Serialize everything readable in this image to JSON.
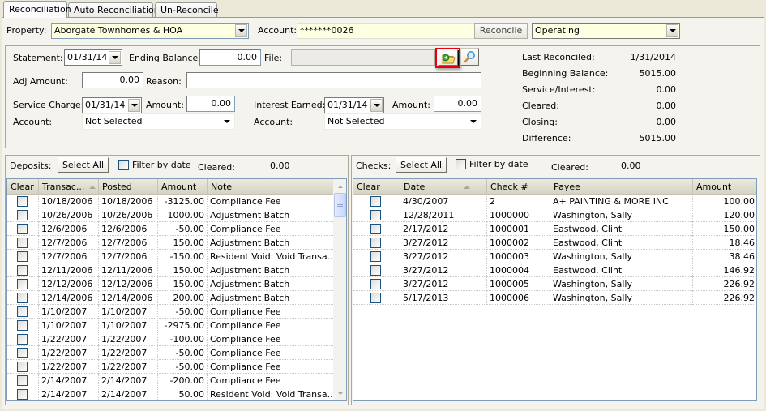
{
  "tabs": [
    {
      "label": "Reconciliation",
      "active": true
    },
    {
      "label": "Auto Reconciliation",
      "active": false
    },
    {
      "label": "Un-Reconcile",
      "active": false
    }
  ],
  "header": {
    "property_label": "Property:",
    "property_value": "Aborgate Townhomes & HOA",
    "account_label": "Account:",
    "account_value": "*******0026",
    "reconcile_button": "Reconcile",
    "account_type_value": "Operating"
  },
  "statement": {
    "statement_label": "Statement:",
    "statement_date": "01/31/14",
    "ending_balance_label": "Ending Balance:",
    "ending_balance_value": "0.00",
    "file_label": "File:",
    "file_value": "",
    "adj_amount_label": "Adj Amount:",
    "adj_amount_value": "0.00",
    "reason_label": "Reason:",
    "reason_value": "",
    "service_charge_label": "Service Charge:",
    "service_charge_date": "01/31/14",
    "service_amount_label": "Amount:",
    "service_amount_value": "0.00",
    "service_account_label": "Account:",
    "service_account_value": "Not Selected",
    "interest_earned_label": "Interest Earned:",
    "interest_earned_date": "01/31/14",
    "interest_amount_label": "Amount:",
    "interest_amount_value": "0.00",
    "interest_account_label": "Account:",
    "interest_account_value": "Not Selected",
    "icons": {
      "open_file": "folder-open-icon",
      "view_file": "magnifier-icon"
    }
  },
  "summary": [
    {
      "label": "Last Reconciled:",
      "value": "1/31/2014"
    },
    {
      "label": "Beginning Balance:",
      "value": "5015.00"
    },
    {
      "label": "Service/Interest:",
      "value": "0.00"
    },
    {
      "label": "Cleared:",
      "value": "0.00"
    },
    {
      "label": "Closing:",
      "value": "0.00"
    },
    {
      "label": "Difference:",
      "value": "5015.00"
    }
  ],
  "deposits": {
    "title": "Deposits:",
    "select_all": "Select All",
    "filter_label": "Filter by date",
    "filter_checked": false,
    "cleared_label": "Cleared:",
    "cleared_value": "0.00",
    "columns": [
      "Clear",
      "Transac...",
      "Posted",
      "Amount",
      "Note"
    ],
    "sorted_column": "Transac...",
    "rows": [
      {
        "clear": false,
        "transaction": "10/18/2006",
        "posted": "10/18/2006",
        "amount": "-3125.00",
        "note": "Compliance Fee"
      },
      {
        "clear": false,
        "transaction": "10/26/2006",
        "posted": "10/26/2006",
        "amount": "1000.00",
        "note": "Adjustment Batch"
      },
      {
        "clear": false,
        "transaction": "12/6/2006",
        "posted": "12/6/2006",
        "amount": "-50.00",
        "note": "Compliance Fee"
      },
      {
        "clear": false,
        "transaction": "12/7/2006",
        "posted": "12/7/2006",
        "amount": "150.00",
        "note": "Adjustment Batch"
      },
      {
        "clear": false,
        "transaction": "12/7/2006",
        "posted": "12/7/2006",
        "amount": "-150.00",
        "note": "Resident Void: Void Transa..."
      },
      {
        "clear": false,
        "transaction": "12/11/2006",
        "posted": "12/11/2006",
        "amount": "150.00",
        "note": "Adjustment Batch"
      },
      {
        "clear": false,
        "transaction": "12/12/2006",
        "posted": "12/12/2006",
        "amount": "150.00",
        "note": "Adjustment Batch"
      },
      {
        "clear": false,
        "transaction": "12/14/2006",
        "posted": "12/14/2006",
        "amount": "200.00",
        "note": "Adjustment Batch"
      },
      {
        "clear": false,
        "transaction": "1/10/2007",
        "posted": "1/10/2007",
        "amount": "-50.00",
        "note": "Compliance Fee"
      },
      {
        "clear": false,
        "transaction": "1/10/2007",
        "posted": "1/10/2007",
        "amount": "-2975.00",
        "note": "Compliance Fee"
      },
      {
        "clear": false,
        "transaction": "1/22/2007",
        "posted": "1/22/2007",
        "amount": "-100.00",
        "note": "Compliance Fee"
      },
      {
        "clear": false,
        "transaction": "1/22/2007",
        "posted": "1/22/2007",
        "amount": "-50.00",
        "note": "Compliance Fee"
      },
      {
        "clear": false,
        "transaction": "1/22/2007",
        "posted": "1/22/2007",
        "amount": "-50.00",
        "note": "Compliance Fee"
      },
      {
        "clear": false,
        "transaction": "2/14/2007",
        "posted": "2/14/2007",
        "amount": "-200.00",
        "note": "Compliance Fee"
      },
      {
        "clear": false,
        "transaction": "2/14/2007",
        "posted": "2/14/2007",
        "amount": "50.00",
        "note": "Resident Void: Void Transa..."
      }
    ]
  },
  "checks": {
    "title": "Checks:",
    "select_all": "Select All",
    "filter_label": "Filter by date",
    "filter_checked": false,
    "cleared_label": "Cleared:",
    "cleared_value": "0.00",
    "columns": [
      "Clear",
      "Date",
      "Check #",
      "Payee",
      "Amount"
    ],
    "sorted_column": "Date",
    "rows": [
      {
        "clear": false,
        "date": "4/30/2007",
        "check": "2",
        "payee": "A+ PAINTING & MORE INC",
        "amount": "100.00"
      },
      {
        "clear": false,
        "date": "12/28/2011",
        "check": "1000000",
        "payee": "Washington, Sally",
        "amount": "120.00"
      },
      {
        "clear": false,
        "date": "2/17/2012",
        "check": "1000001",
        "payee": "Eastwood, Clint",
        "amount": "150.00"
      },
      {
        "clear": false,
        "date": "3/27/2012",
        "check": "1000002",
        "payee": "Eastwood, Clint",
        "amount": "18.46"
      },
      {
        "clear": false,
        "date": "3/27/2012",
        "check": "1000003",
        "payee": "Washington, Sally",
        "amount": "38.46"
      },
      {
        "clear": false,
        "date": "3/27/2012",
        "check": "1000004",
        "payee": "Eastwood, Clint",
        "amount": "146.92"
      },
      {
        "clear": false,
        "date": "3/27/2012",
        "check": "1000005",
        "payee": "Washington, Sally",
        "amount": "226.92"
      },
      {
        "clear": false,
        "date": "5/17/2013",
        "check": "1000006",
        "payee": "Washington, Sally",
        "amount": "226.92"
      }
    ]
  },
  "colors": {
    "input_highlight": "#ffffe1",
    "highlight_box": "#e8000c",
    "panel_bg": "#f4f3ee"
  }
}
